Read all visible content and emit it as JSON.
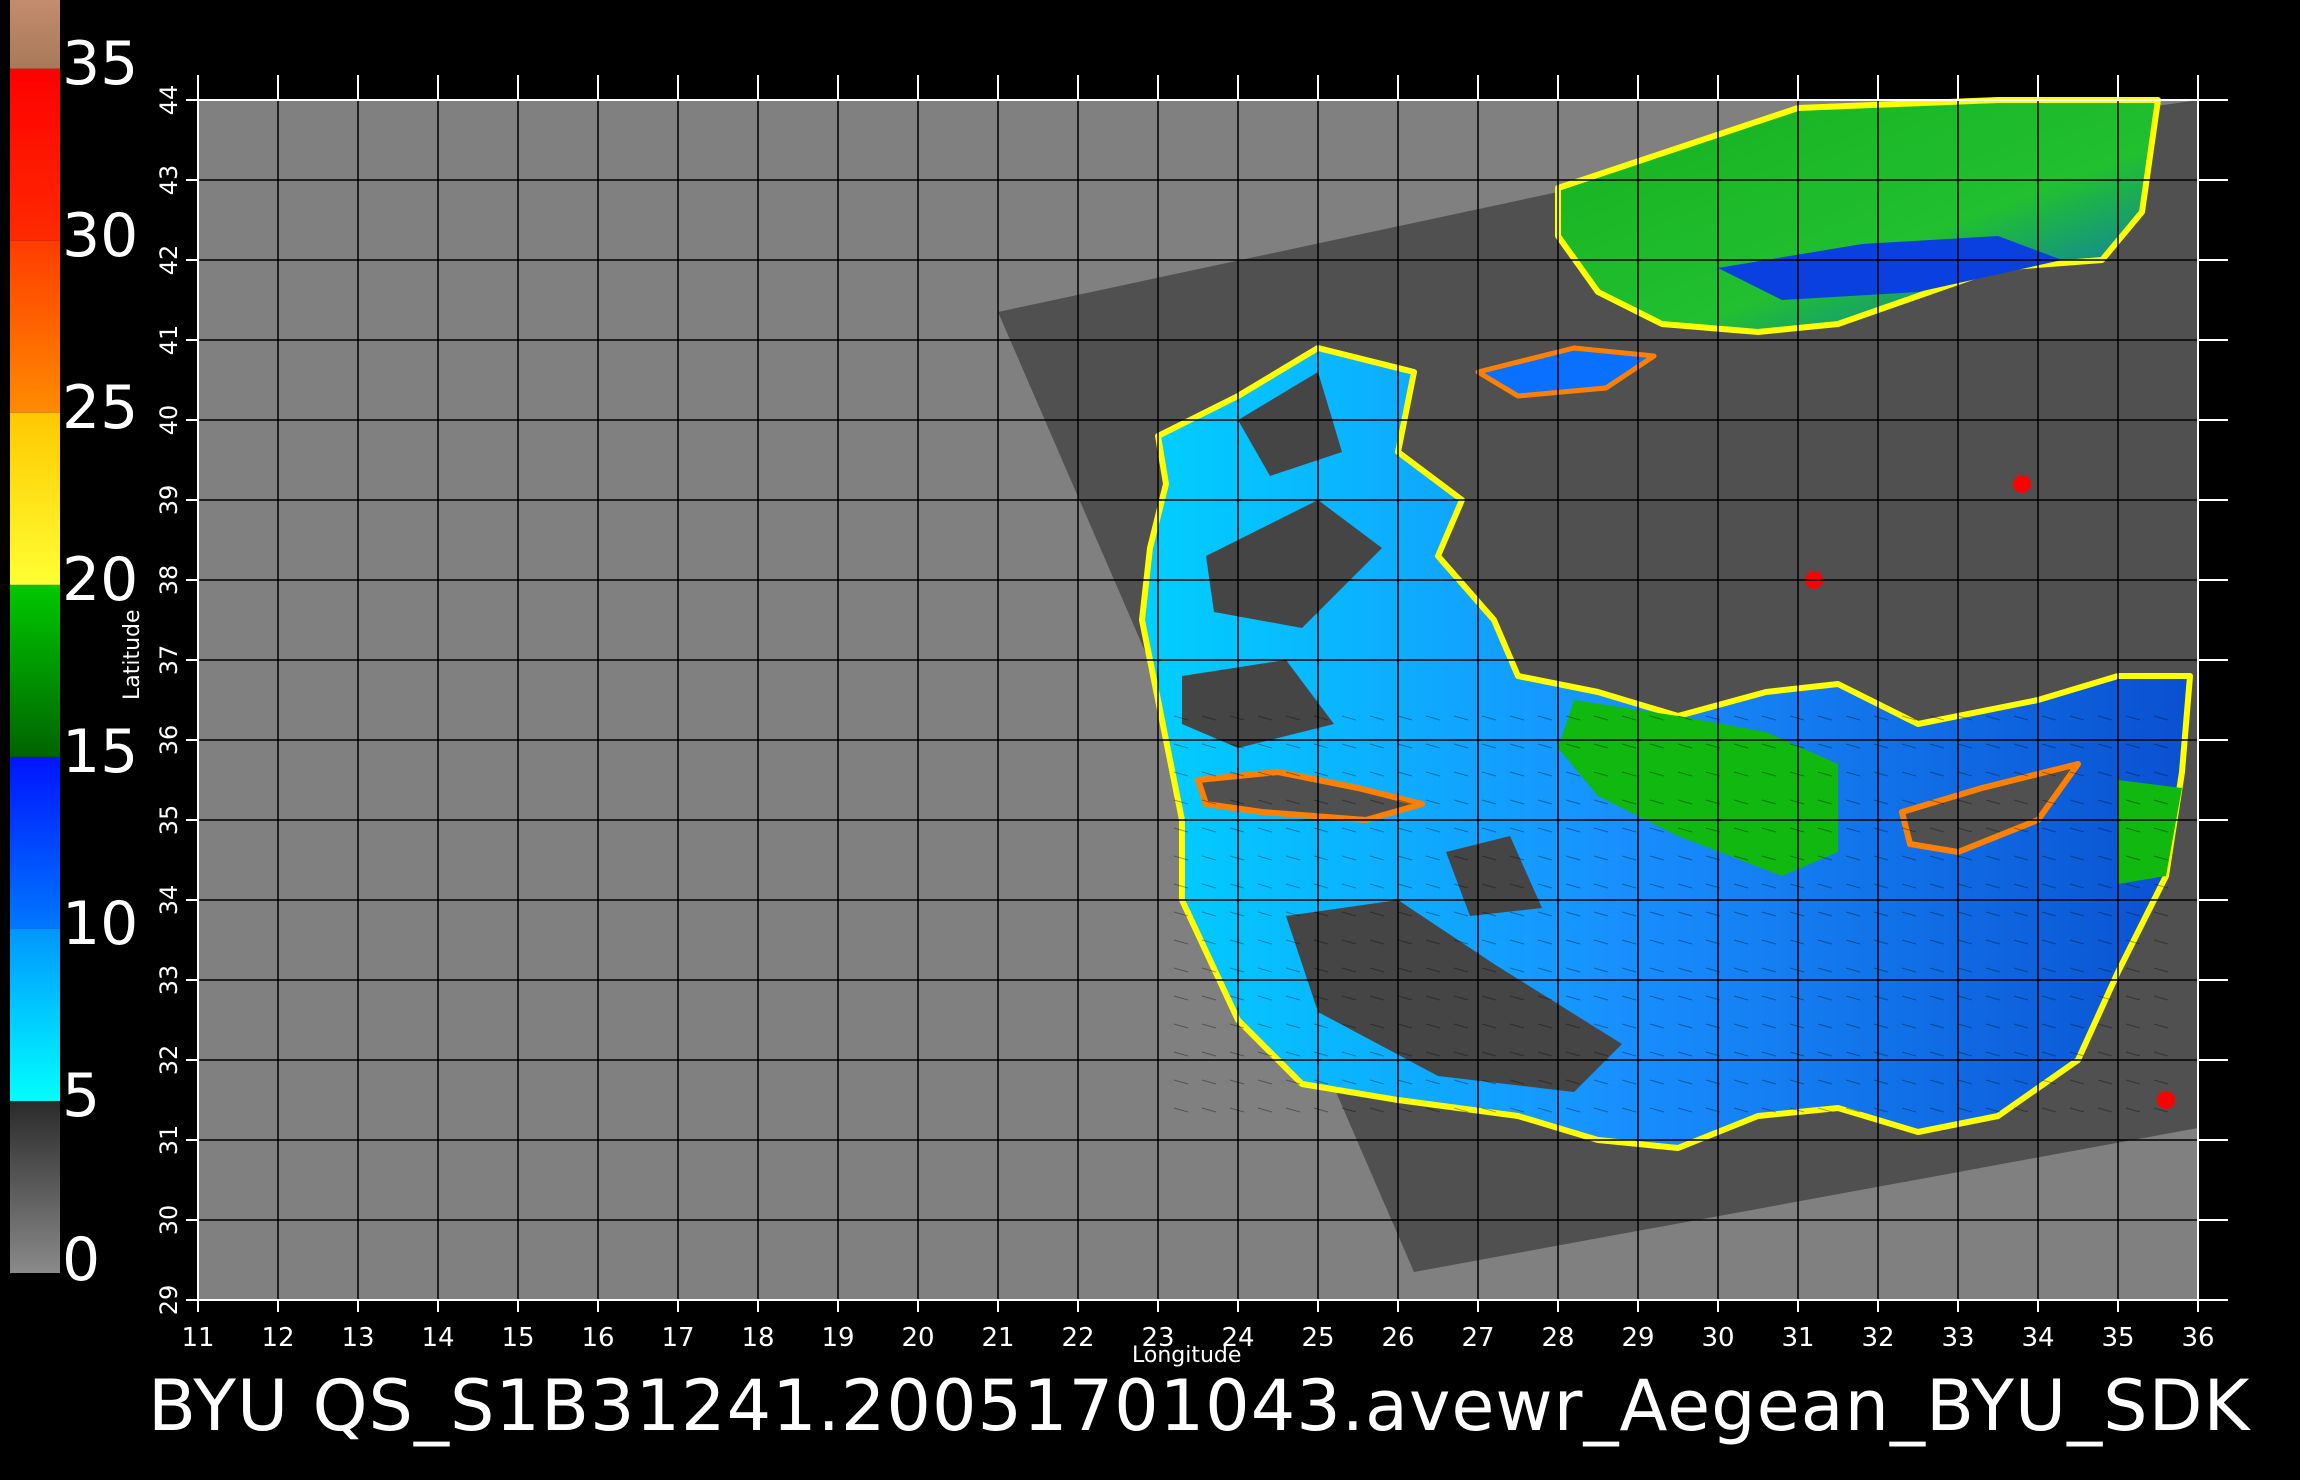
{
  "title": "BYU  QS_S1B31241.20051701043.avewr_Aegean_BYU_SDK",
  "colorbar": {
    "labels": [
      "35",
      "30",
      "25",
      "20",
      "15",
      "10",
      "5",
      "0"
    ],
    "segments": [
      {
        "from": 35,
        "to": 37,
        "colors": [
          "#c38c6e",
          "#a9785a"
        ]
      },
      {
        "from": 30,
        "to": 35,
        "colors": [
          "#ff0000",
          "#ff2a00"
        ]
      },
      {
        "from": 25,
        "to": 30,
        "colors": [
          "#ff3c00",
          "#ff8c00"
        ]
      },
      {
        "from": 20,
        "to": 25,
        "colors": [
          "#ffc800",
          "#ffff32"
        ]
      },
      {
        "from": 15,
        "to": 20,
        "colors": [
          "#00c800",
          "#006400"
        ]
      },
      {
        "from": 10,
        "to": 15,
        "colors": [
          "#0014ff",
          "#0078ff"
        ]
      },
      {
        "from": 5,
        "to": 10,
        "colors": [
          "#0096ff",
          "#00ffff"
        ]
      },
      {
        "from": 0,
        "to": 5,
        "colors": [
          "#2a2a2a",
          "#8a8a8a"
        ]
      }
    ]
  },
  "axes": {
    "xlabel": "Longitude",
    "ylabel": "Latitude",
    "x_ticks": [
      "11",
      "12",
      "13",
      "14",
      "15",
      "16",
      "17",
      "18",
      "19",
      "20",
      "21",
      "22",
      "23",
      "24",
      "25",
      "26",
      "27",
      "28",
      "29",
      "30",
      "31",
      "32",
      "33",
      "34",
      "35",
      "36"
    ],
    "y_ticks": [
      "29",
      "30",
      "31",
      "32",
      "33",
      "34",
      "35",
      "36",
      "37",
      "38",
      "39",
      "40",
      "41",
      "42",
      "43",
      "44"
    ],
    "xlim": [
      11,
      36
    ],
    "ylim": [
      29,
      44
    ]
  },
  "map": {
    "background_color": "#808080",
    "swath_color": "#505050",
    "grid_color": "#000000",
    "land_color": "#454545",
    "sea_colors": [
      "#00b4ff",
      "#0a5ad8",
      "#0088ff"
    ],
    "wind_high_color": "#10b810",
    "coast_colors": [
      "#ffff00",
      "#ff8000",
      "#ff0000",
      "#ff00ff"
    ]
  }
}
